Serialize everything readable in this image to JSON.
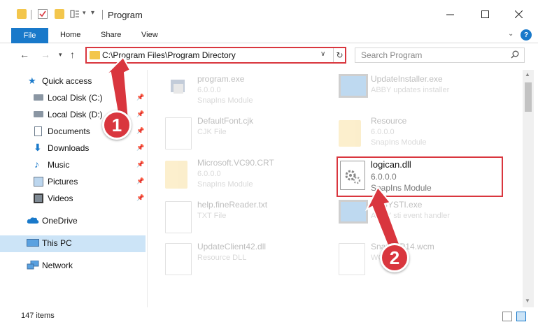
{
  "window": {
    "title": "Program"
  },
  "ribbon": {
    "file": "File",
    "tabs": [
      "Home",
      "Share",
      "View"
    ]
  },
  "address": {
    "path": "C:\\Program Files\\Program Directory"
  },
  "search": {
    "placeholder": "Search Program"
  },
  "sidebar": {
    "items": [
      {
        "label": "Quick access",
        "icon": "star-icon",
        "pinned": false
      },
      {
        "label": "Local Disk (C:)",
        "icon": "drive-icon",
        "pinned": true
      },
      {
        "label": "Local Disk (D:)",
        "icon": "drive-icon",
        "pinned": true
      },
      {
        "label": "Documents",
        "icon": "documents-icon",
        "pinned": true
      },
      {
        "label": "Downloads",
        "icon": "download-icon",
        "pinned": true
      },
      {
        "label": "Music",
        "icon": "music-icon",
        "pinned": true
      },
      {
        "label": "Pictures",
        "icon": "pictures-icon",
        "pinned": true
      },
      {
        "label": "Videos",
        "icon": "videos-icon",
        "pinned": true
      },
      {
        "label": "OneDrive",
        "icon": "cloud-icon",
        "pinned": false
      },
      {
        "label": "This PC",
        "icon": "computer-icon",
        "pinned": false
      },
      {
        "label": "Network",
        "icon": "network-icon",
        "pinned": false
      }
    ]
  },
  "files": [
    {
      "name": "program.exe",
      "line2": "6.0.0.0",
      "line3": "SnapIns Module",
      "kind": "exe"
    },
    {
      "name": "UpdateInstaller.exe",
      "line2": "ABBY updates installer",
      "line3": "",
      "kind": "installer"
    },
    {
      "name": "DefaultFont.cjk",
      "line2": "CJK File",
      "line3": "",
      "kind": "doc"
    },
    {
      "name": "Resource",
      "line2": "6.0.0.0",
      "line3": "SnapIns Module",
      "kind": "folder"
    },
    {
      "name": "Microsoft.VC90.CRT",
      "line2": "6.0.0.0",
      "line3": "SnapIns Module",
      "kind": "folder"
    },
    {
      "name": "logican.dll",
      "line2": "6.0.0.0",
      "line3": "SnapIns Module",
      "kind": "dll"
    },
    {
      "name": "help.fineReader.txt",
      "line2": "TXT File",
      "line3": "",
      "kind": "doc"
    },
    {
      "name": "ABBYSTI.exe",
      "line2": "ABBY sti event handler",
      "line3": "",
      "kind": "installer"
    },
    {
      "name": "UpdateClient42.dll",
      "line2": "Resource DLL",
      "line3": "",
      "kind": "doc"
    },
    {
      "name": "SnapIMP14.wcm",
      "line2": "WCM",
      "line3": "",
      "kind": "doc"
    }
  ],
  "status": {
    "count": "147 items"
  },
  "callouts": [
    "1",
    "2"
  ],
  "colors": {
    "accent": "#1979ca",
    "highlight": "#d9363e",
    "selection": "#cce4f7",
    "folder": "#f3c64c"
  }
}
